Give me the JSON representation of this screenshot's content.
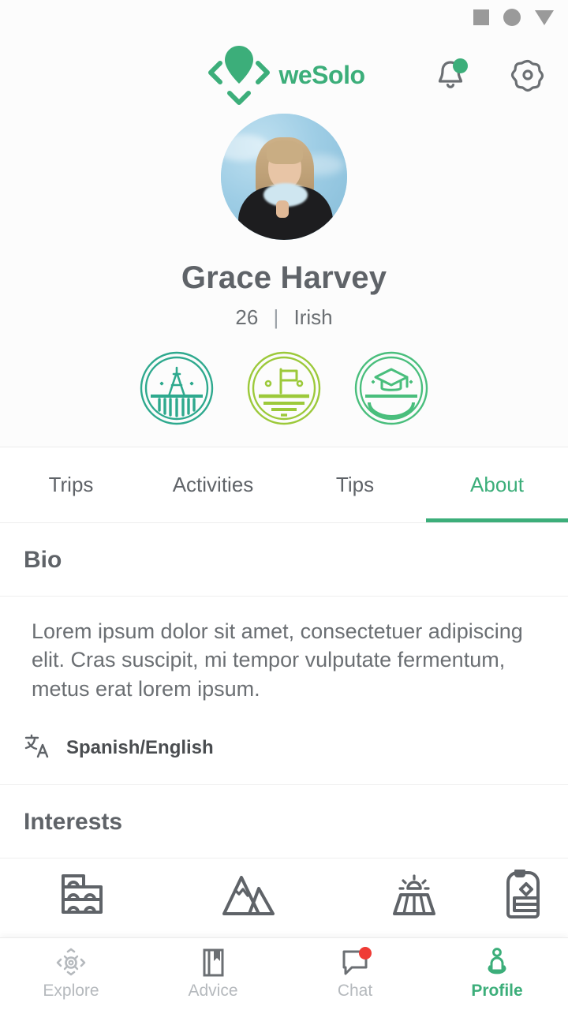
{
  "system_bar": {
    "square_icon": "square-icon",
    "circle_icon": "circle-icon",
    "triangle_icon": "triangle-down-icon"
  },
  "header": {
    "brand_name": "weSolo",
    "logo_icon": "location-pin-compass-icon",
    "notification_icon": "bell-icon",
    "notification_badge_color": "#3CAE7A",
    "settings_icon": "gear-icon",
    "accent_color": "#3CAE7A"
  },
  "profile": {
    "avatar_alt": "profile-photo",
    "name": "Grace Harvey",
    "age": "26",
    "separator": "|",
    "nationality": "Irish",
    "badges": [
      {
        "name": "eiffel-tower-badge",
        "color": "#2EA98E"
      },
      {
        "name": "flag-badge",
        "color": "#9CC93A"
      },
      {
        "name": "graduation-cap-badge",
        "color": "#49BE7C"
      }
    ]
  },
  "tabs": [
    {
      "label": "Trips",
      "active": false
    },
    {
      "label": "Activities",
      "active": false
    },
    {
      "label": "Tips",
      "active": false
    },
    {
      "label": "About",
      "active": true
    }
  ],
  "about": {
    "bio_heading": "Bio",
    "bio_text": "Lorem ipsum dolor sit amet, consectetuer adipiscing elit. Cras suscipit, mi tempor vulputate fermentum, metus erat lorem ipsum.",
    "language_icon": "translate-icon",
    "languages": "Spanish/English",
    "interests_heading": "Interests",
    "interests": [
      {
        "name": "architecture-icon"
      },
      {
        "name": "mountains-icon"
      },
      {
        "name": "festival-icon"
      },
      {
        "name": "backpack-icon"
      }
    ]
  },
  "bottom_nav": [
    {
      "label": "Explore",
      "icon": "compass-icon",
      "active": false,
      "badge": false
    },
    {
      "label": "Advice",
      "icon": "book-bookmark-icon",
      "active": false,
      "badge": false
    },
    {
      "label": "Chat",
      "icon": "chat-bubble-icon",
      "active": false,
      "badge": true
    },
    {
      "label": "Profile",
      "icon": "person-pin-icon",
      "active": true,
      "badge": false
    }
  ]
}
